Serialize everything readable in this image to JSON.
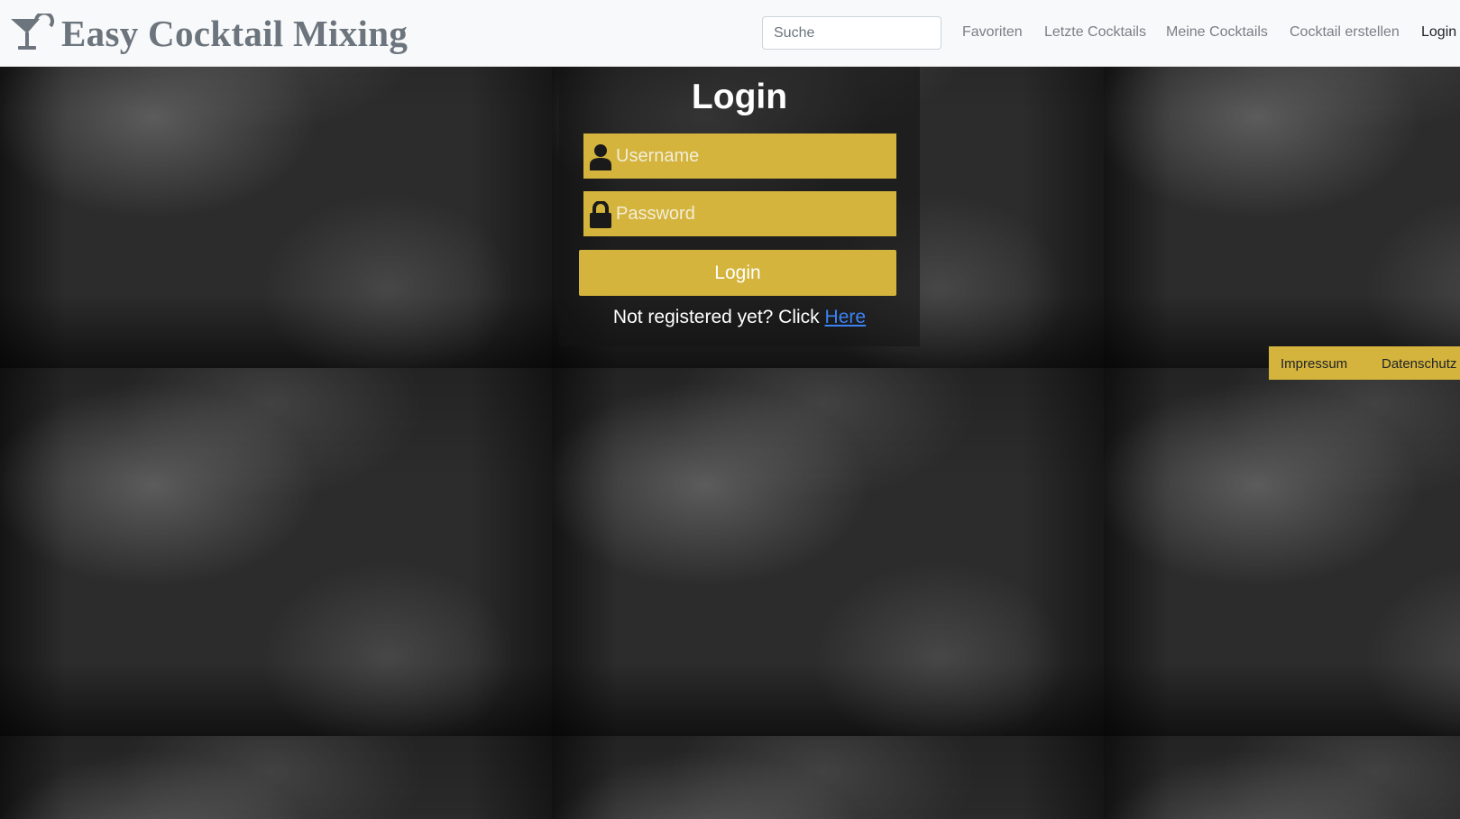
{
  "brand": {
    "title": "Easy Cocktail Mixing",
    "logo_icon": "cocktail-glass-icon"
  },
  "search": {
    "placeholder": "Suche",
    "value": ""
  },
  "nav": {
    "items": [
      {
        "label": "Favoriten"
      },
      {
        "label": "Letzte Cocktails"
      },
      {
        "label": "Meine Cocktails"
      },
      {
        "label": "Cocktail erstellen"
      },
      {
        "label": "Login"
      }
    ]
  },
  "login": {
    "title": "Login",
    "username": {
      "placeholder": "Username",
      "value": "",
      "icon": "user-icon"
    },
    "password": {
      "placeholder": "Password",
      "value": "",
      "icon": "lock-icon"
    },
    "submit_label": "Login",
    "register_text": "Not registered yet? Click",
    "register_link": "Here"
  },
  "footer": {
    "links": [
      {
        "label": "Impressum"
      },
      {
        "label": "Datenschutz"
      }
    ]
  },
  "colors": {
    "accent": "#d4b43c",
    "navbar_bg": "#f8f9fa",
    "link": "#3b82f6",
    "brand_text": "#6c757d"
  }
}
